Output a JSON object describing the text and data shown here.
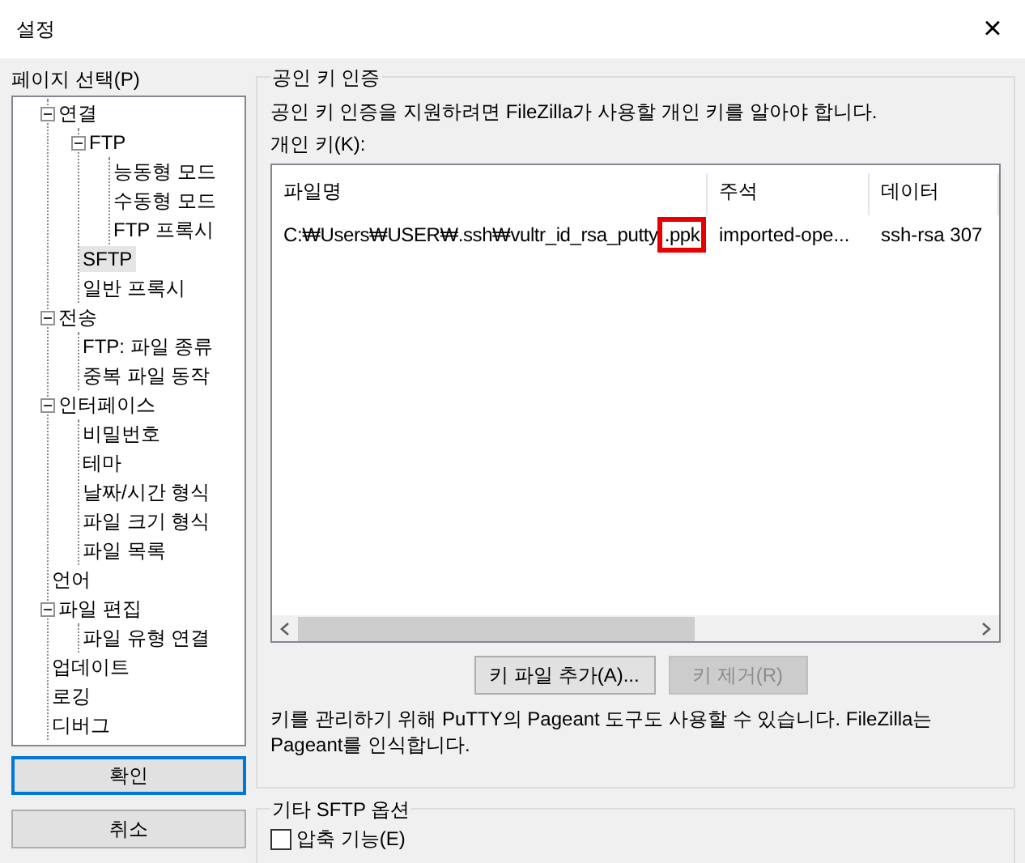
{
  "window": {
    "title": "설정",
    "close": "×"
  },
  "page_select": {
    "label": "페이지 선택(P)",
    "tree": [
      {
        "label": "연결",
        "expanded": true,
        "selected": false,
        "children": [
          {
            "label": "FTP",
            "expanded": true,
            "selected": false,
            "children": [
              {
                "label": "능동형 모드",
                "selected": false
              },
              {
                "label": "수동형 모드",
                "selected": false
              },
              {
                "label": "FTP 프록시",
                "selected": false
              }
            ]
          },
          {
            "label": "SFTP",
            "selected": true
          },
          {
            "label": "일반 프록시",
            "selected": false
          }
        ]
      },
      {
        "label": "전송",
        "expanded": true,
        "selected": false,
        "children": [
          {
            "label": "FTP: 파일 종류",
            "selected": false
          },
          {
            "label": "중복 파일 동작",
            "selected": false
          }
        ]
      },
      {
        "label": "인터페이스",
        "expanded": true,
        "selected": false,
        "children": [
          {
            "label": "비밀번호",
            "selected": false
          },
          {
            "label": "테마",
            "selected": false
          },
          {
            "label": "날짜/시간 형식",
            "selected": false
          },
          {
            "label": "파일 크기 형식",
            "selected": false
          },
          {
            "label": "파일 목록",
            "selected": false
          }
        ]
      },
      {
        "label": "언어",
        "selected": false
      },
      {
        "label": "파일 편집",
        "expanded": true,
        "selected": false,
        "children": [
          {
            "label": "파일 유형 연결",
            "selected": false
          }
        ]
      },
      {
        "label": "업데이트",
        "selected": false
      },
      {
        "label": "로깅",
        "selected": false
      },
      {
        "label": "디버그",
        "selected": false
      }
    ]
  },
  "dialog_buttons": [
    {
      "label": "확인",
      "default": true
    },
    {
      "label": "취소",
      "default": false
    }
  ],
  "public_key_auth": {
    "title": "공인 키 인증",
    "description": "공인 키 인증을 지원하려면 FileZilla가 사용할 개인 키를 알아야 합니다.",
    "list_label": "개인 키(K):",
    "columns": [
      "파일명",
      "주석",
      "데이터"
    ],
    "rows": [
      {
        "file": "C:₩Users₩USER₩.ssh₩vultr_id_rsa_putty",
        "file_highlight": ".ppk",
        "comment": "imported-ope...",
        "data": "ssh-rsa 307"
      }
    ],
    "buttons": [
      {
        "label": "키 파일 추가(A)...",
        "disabled": false
      },
      {
        "label": "키 제거(R)",
        "disabled": true
      }
    ],
    "note": "키를 관리하기 위해 PuTTY의 Pageant 도구도 사용할 수 있습니다. FileZilla는 Pageant를 인식합니다."
  },
  "other_sftp": {
    "title": "기타 SFTP 옵션",
    "checkbox": {
      "label": "압축 기능(E)",
      "checked": false
    }
  }
}
